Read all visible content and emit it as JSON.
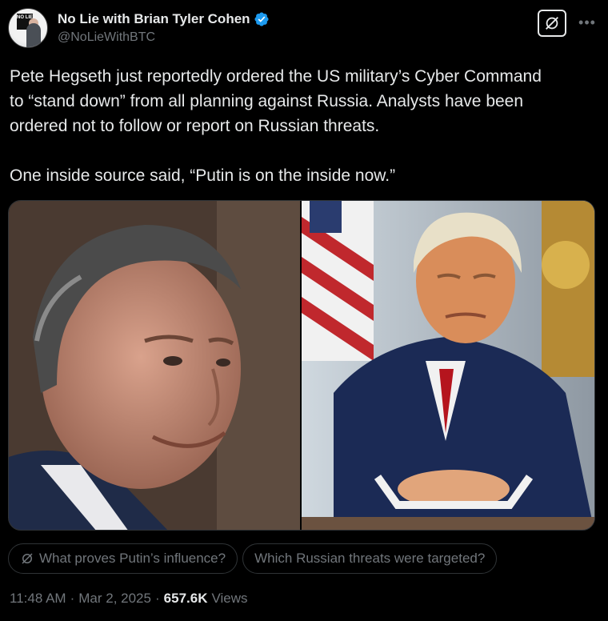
{
  "author": {
    "display_name": "No Lie with Brian Tyler Cohen",
    "handle": "@NoLieWithBTC",
    "avatar_logo_text": "NO LIE"
  },
  "tweet": {
    "text": "Pete Hegseth just reportedly ordered the US military’s Cyber Command\nto “stand down” from all planning against Russia. Analysts have been\nordered not to follow or report on Russian threats.\n\nOne inside source said, “Putin is on the inside now.”"
  },
  "icons": {
    "verified": "verified-badge-icon",
    "grok": "grok-icon",
    "more": "more-icon"
  },
  "colors": {
    "verified_blue": "#1d9bf0",
    "text_primary": "#e7e9ea",
    "text_secondary": "#71767b",
    "background": "#000000"
  },
  "suggestions": [
    {
      "label": "What proves Putin’s influence?",
      "has_icon": true
    },
    {
      "label": "Which Russian threats were targeted?",
      "has_icon": false
    }
  ],
  "meta": {
    "time": "11:48 AM",
    "separator": "·",
    "date": "Mar 2, 2025",
    "views_count": "657.6K",
    "views_label": "Views"
  }
}
